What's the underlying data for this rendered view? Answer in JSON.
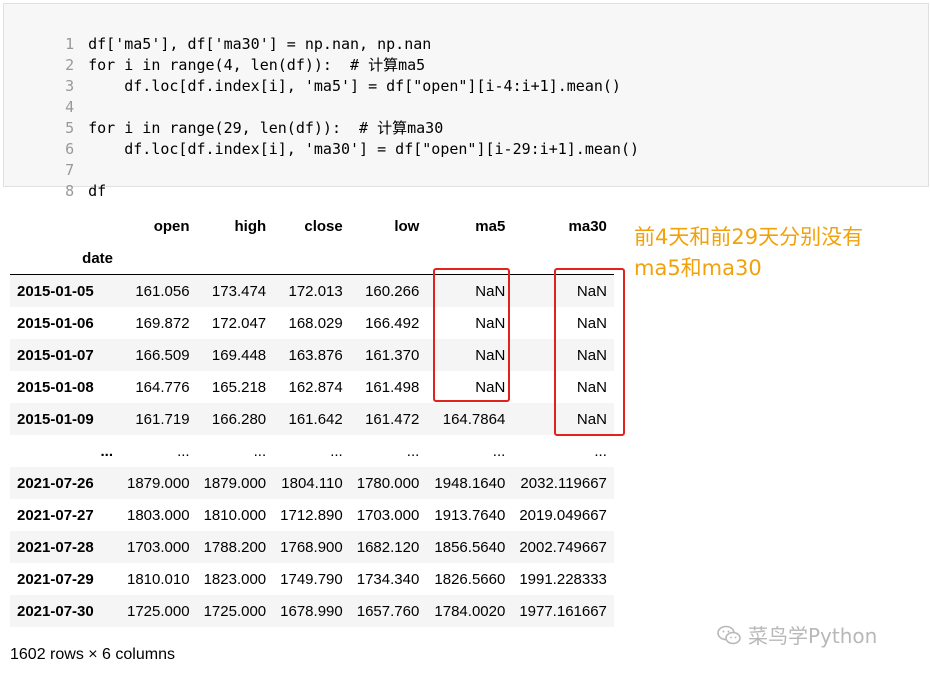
{
  "code_cell": {
    "line_numbers": [
      "1",
      "2",
      "3",
      "4",
      "5",
      "6",
      "7",
      "8"
    ],
    "lines": [
      "df['ma5'], df['ma30'] = np.nan, np.nan",
      "for i in range(4, len(df)):  # 计算ma5",
      "    df.loc[df.index[i], 'ma5'] = df[\"open\"][i-4:i+1].mean()",
      "",
      "for i in range(29, len(df)):  # 计算ma30",
      "    df.loc[df.index[i], 'ma30'] = df[\"open\"][i-29:i+1].mean()",
      "",
      "df"
    ]
  },
  "dataframe": {
    "columns": [
      "open",
      "high",
      "close",
      "low",
      "ma5",
      "ma30"
    ],
    "index_name": "date",
    "rows": [
      {
        "date": "2015-01-05",
        "values": [
          "161.056",
          "173.474",
          "172.013",
          "160.266",
          "NaN",
          "NaN"
        ]
      },
      {
        "date": "2015-01-06",
        "values": [
          "169.872",
          "172.047",
          "168.029",
          "166.492",
          "NaN",
          "NaN"
        ]
      },
      {
        "date": "2015-01-07",
        "values": [
          "166.509",
          "169.448",
          "163.876",
          "161.370",
          "NaN",
          "NaN"
        ]
      },
      {
        "date": "2015-01-08",
        "values": [
          "164.776",
          "165.218",
          "162.874",
          "161.498",
          "NaN",
          "NaN"
        ]
      },
      {
        "date": "2015-01-09",
        "values": [
          "161.719",
          "166.280",
          "161.642",
          "161.472",
          "164.7864",
          "NaN"
        ]
      },
      {
        "date": "...",
        "values": [
          "...",
          "...",
          "...",
          "...",
          "...",
          "..."
        ]
      },
      {
        "date": "2021-07-26",
        "values": [
          "1879.000",
          "1879.000",
          "1804.110",
          "1780.000",
          "1948.1640",
          "2032.119667"
        ]
      },
      {
        "date": "2021-07-27",
        "values": [
          "1803.000",
          "1810.000",
          "1712.890",
          "1703.000",
          "1913.7640",
          "2019.049667"
        ]
      },
      {
        "date": "2021-07-28",
        "values": [
          "1703.000",
          "1788.200",
          "1768.900",
          "1682.120",
          "1856.5640",
          "2002.749667"
        ]
      },
      {
        "date": "2021-07-29",
        "values": [
          "1810.010",
          "1823.000",
          "1749.790",
          "1734.340",
          "1826.5660",
          "1991.228333"
        ]
      },
      {
        "date": "2021-07-30",
        "values": [
          "1725.000",
          "1725.000",
          "1678.990",
          "1657.760",
          "1784.0020",
          "1977.161667"
        ]
      }
    ],
    "shape_note": "1602 rows × 6 columns"
  },
  "annotation": {
    "line1": "前4天和前29天分别没有",
    "line2": "ma5和ma30",
    "color": "#f2a10a"
  },
  "watermark": {
    "text": "菜鸟学Python",
    "icon": "wechat-icon"
  },
  "highlight_color": "#e0241b"
}
